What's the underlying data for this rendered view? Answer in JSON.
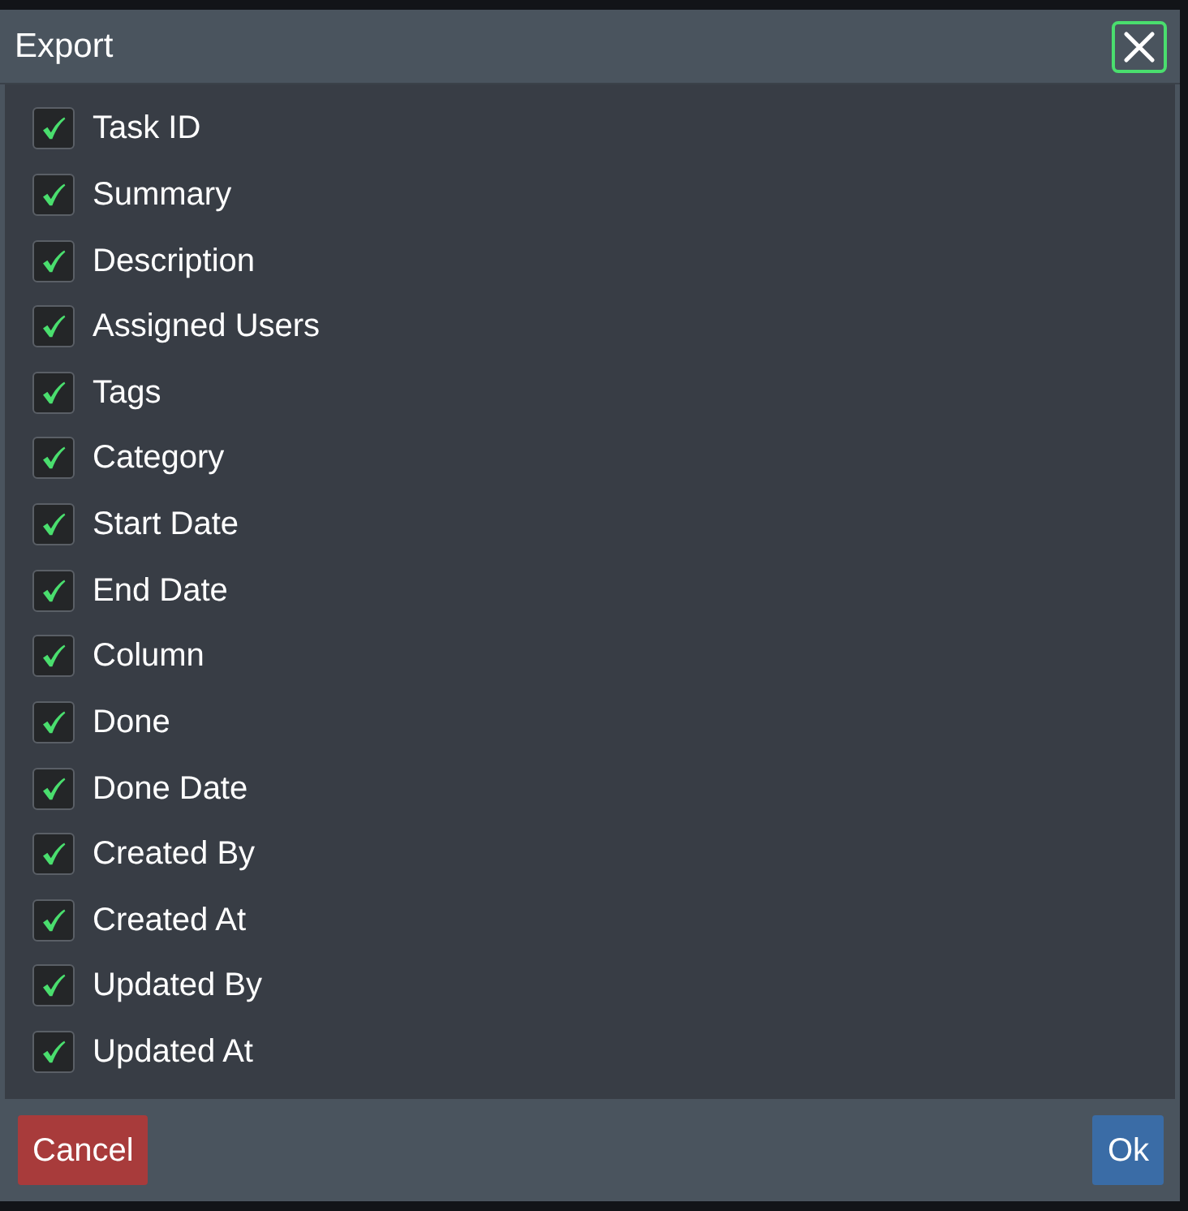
{
  "dialog": {
    "title": "Export",
    "fields": [
      {
        "label": "Task ID",
        "checked": true
      },
      {
        "label": "Summary",
        "checked": true
      },
      {
        "label": "Description",
        "checked": true
      },
      {
        "label": "Assigned Users",
        "checked": true
      },
      {
        "label": "Tags",
        "checked": true
      },
      {
        "label": "Category",
        "checked": true
      },
      {
        "label": "Start Date",
        "checked": true
      },
      {
        "label": "End Date",
        "checked": true
      },
      {
        "label": "Column",
        "checked": true
      },
      {
        "label": "Done",
        "checked": true
      },
      {
        "label": "Done Date",
        "checked": true
      },
      {
        "label": "Created By",
        "checked": true
      },
      {
        "label": "Created At",
        "checked": true
      },
      {
        "label": "Updated By",
        "checked": true
      },
      {
        "label": "Updated At",
        "checked": true
      }
    ],
    "buttons": [
      {
        "label": "Cancel",
        "kind": "cancel"
      },
      {
        "label": "Ok",
        "kind": "ok"
      }
    ]
  }
}
